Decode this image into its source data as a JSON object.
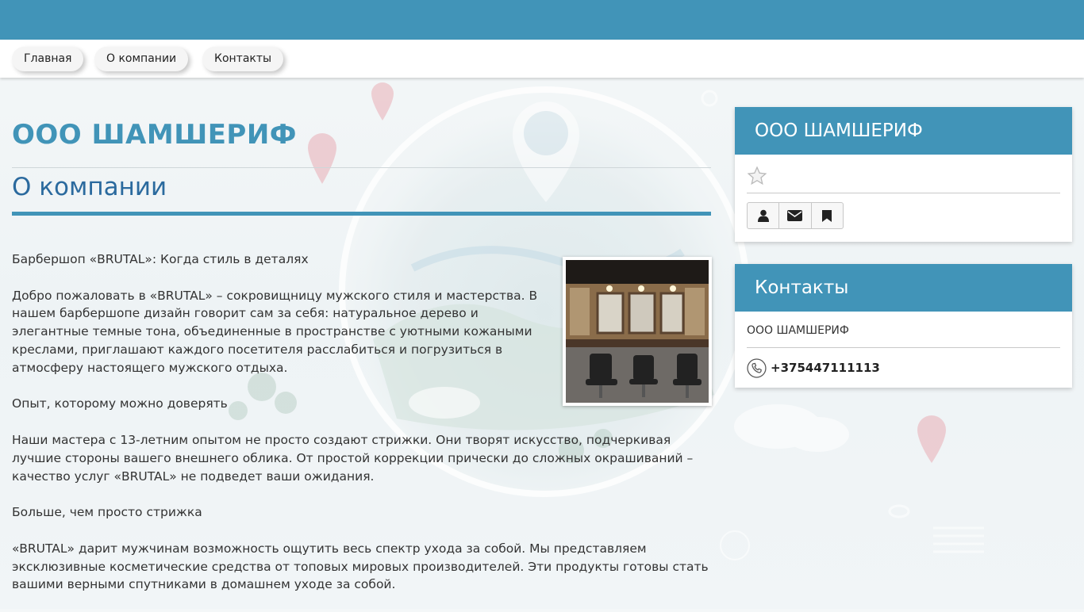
{
  "nav": {
    "items": [
      {
        "label": "Главная"
      },
      {
        "label": "О компании"
      },
      {
        "label": "Контакты"
      }
    ]
  },
  "main": {
    "company_name": "ООО ШАМШЕРИФ",
    "section_title": "О компании",
    "paragraphs": [
      "Барбершоп «BRUTAL»: Когда стиль в деталях",
      "Добро пожаловать в «BRUTAL» – сокровищницу мужского стиля и мастерства. В нашем барбершопе дизайн говорит сам за себя: натуральное дерево и элегантные темные тона, объединенные в пространстве с уютными кожаными креслами, приглашают каждого посетителя расслабиться и погрузиться в атмосферу настоящего мужского отдыха.",
      "Опыт, которому можно доверять",
      "Наши мастера с 13-летним опытом не просто создают стрижки. Они творят искусство, подчеркивая лучшие стороны вашего внешнего облика. От простой коррекции прически до сложных окрашиваний – качество услуг «BRUTAL» не подведет ваши ожидания.",
      "Больше, чем просто стрижка",
      "«BRUTAL» дарит мужчинам возможность ощутить весь спектр ухода за собой. Мы представляем эксклюзивные косметические средства от топовых мировых производителей. Эти продукты готовы стать вашими верными спутниками в домашнем уходе за собой."
    ],
    "photo_icon": "barbershop-interior-photo"
  },
  "company_panel": {
    "title": "ООО ШАМШЕРИФ",
    "rating_icon": "star-outline-icon",
    "buttons": [
      {
        "icon": "user-icon"
      },
      {
        "icon": "envelope-icon"
      },
      {
        "icon": "bookmark-icon"
      }
    ]
  },
  "contacts_panel": {
    "title": "Контакты",
    "name": "ООО ШАМШЕРИФ",
    "phone": "+375447111113",
    "phone_icon": "phone-icon"
  },
  "colors": {
    "accent": "#4194b8",
    "heading": "#2b6a9e",
    "text": "#333333"
  }
}
